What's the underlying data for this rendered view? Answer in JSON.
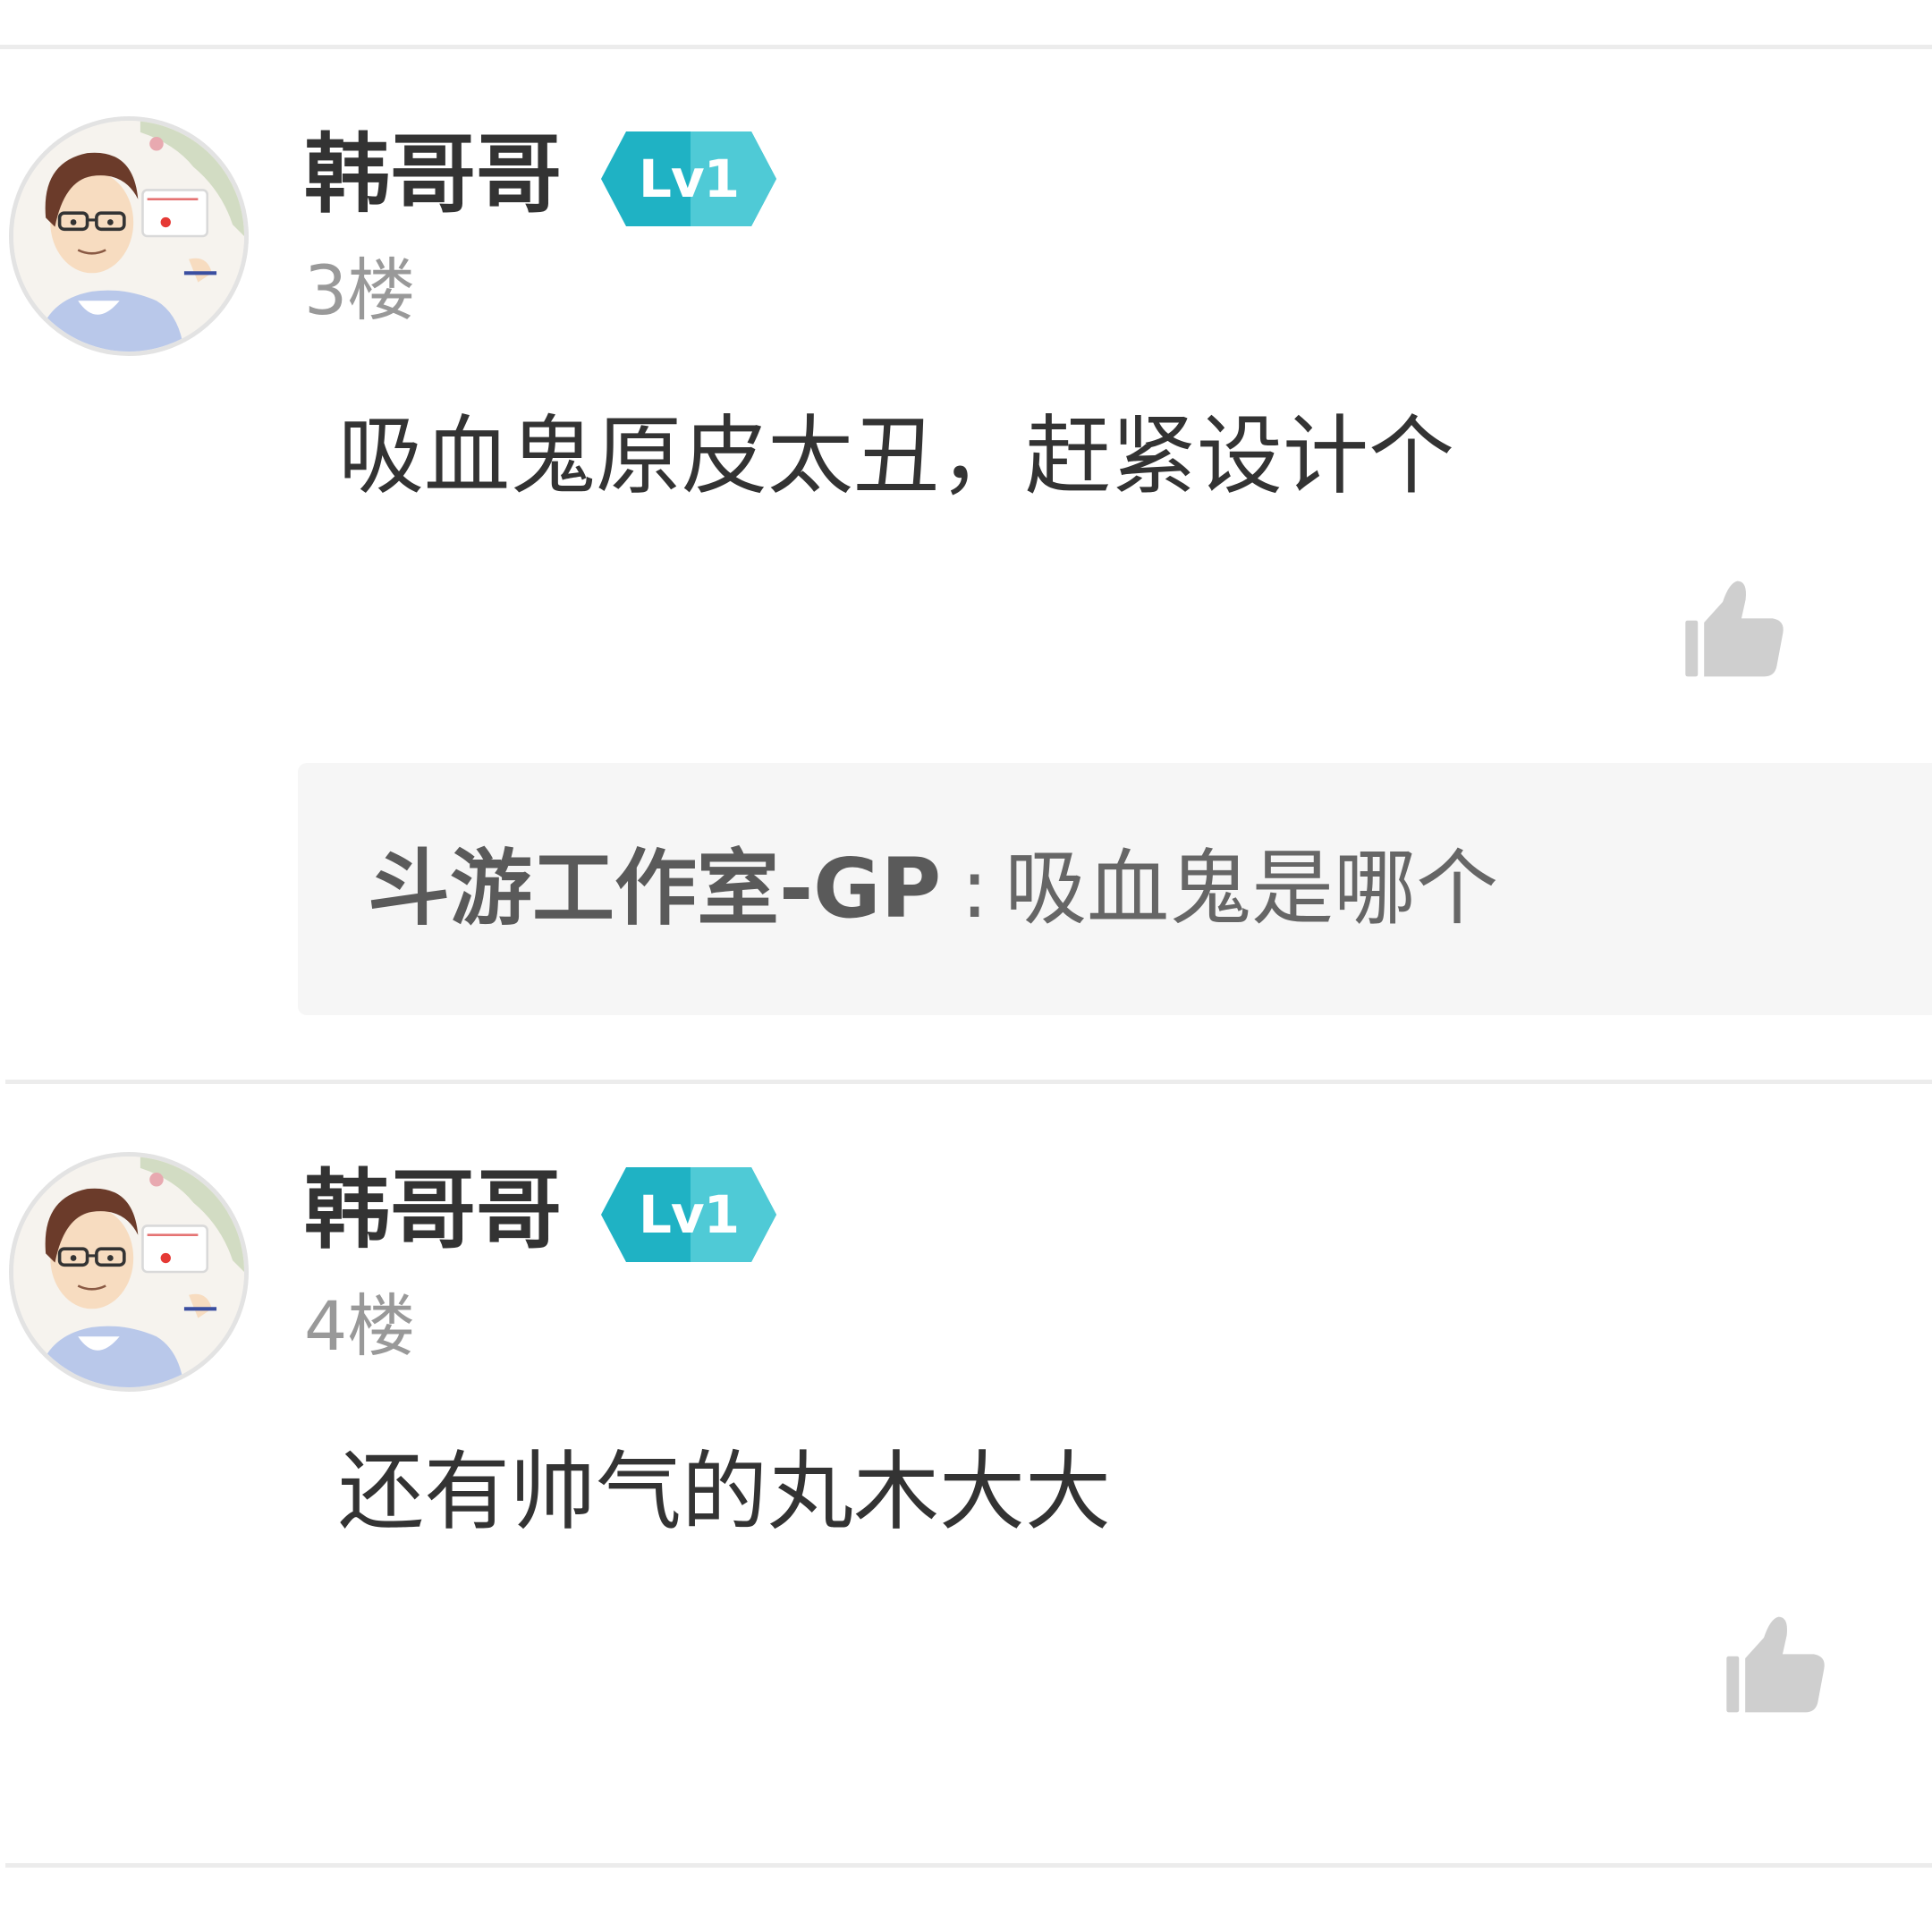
{
  "comments": [
    {
      "username": "韩哥哥",
      "level": "Lv1",
      "floor": "3楼",
      "content": "吸血鬼原皮太丑，赶紧设计个",
      "reply": {
        "author": "斗游工作室-GP",
        "separator": ":",
        "text": "吸血鬼是哪个"
      },
      "like_icon": "thumbs-up-icon"
    },
    {
      "username": "韩哥哥",
      "level": "Lv1",
      "floor": "4楼",
      "content": "还有帅气的丸木大大",
      "like_icon": "thumbs-up-icon"
    }
  ],
  "colors": {
    "badge_dark": "#1fb2c4",
    "badge_light": "#4fcad6",
    "text_primary": "#333333",
    "text_secondary": "#999999",
    "like_icon": "#cfcfcf",
    "reply_bg": "#f6f6f6",
    "divider": "#ececec"
  }
}
